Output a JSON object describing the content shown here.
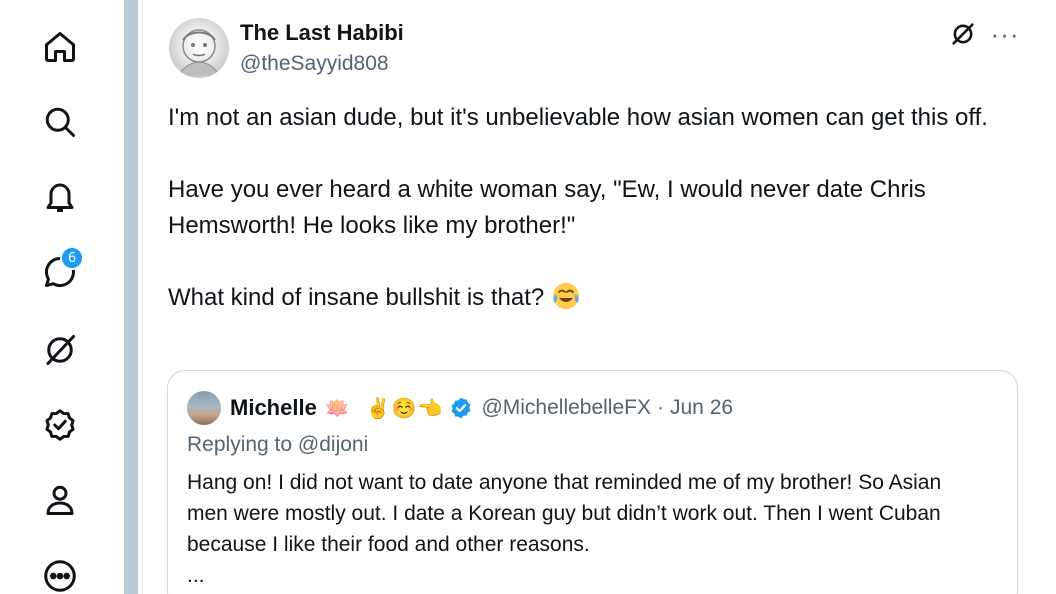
{
  "nav": {
    "items": [
      {
        "name": "home-icon"
      },
      {
        "name": "search-icon"
      },
      {
        "name": "notifications-icon"
      },
      {
        "name": "messages-icon"
      },
      {
        "name": "grok-icon"
      },
      {
        "name": "verified-orgs-icon"
      },
      {
        "name": "profile-icon"
      },
      {
        "name": "more-icon"
      }
    ],
    "messages_badge": "6"
  },
  "tweet": {
    "author_name": "The Last Habibi",
    "author_handle": "@theSayyid808",
    "text": {
      "line1": "I'm not an asian dude, but it's unbelievable how asian women can get this off.",
      "line2": "Have you ever heard a white woman say, \"Ew, I would never date Chris Hemsworth! He looks like my brother!\"",
      "line3": "What kind of insane bullshit is that?"
    },
    "emoji_icon": "face-with-tears-of-joy-icon"
  },
  "quote": {
    "author_name": "Michelle",
    "name_emoji": "🪷",
    "emojis": "✌️☺️👈",
    "handle": "@MichellebelleFX",
    "separator": "·",
    "date": "Jun 26",
    "replying_prefix": "Replying to",
    "replying_handle": "@dijoni",
    "body": "Hang on!  I did not want to date anyone that reminded me of my brother! So Asian men were mostly out.  I date a Korean guy but didn’t work out. Then I went Cuban because I like their food and other reasons.",
    "ellipsis": "..."
  },
  "colors": {
    "text": "#0f1419",
    "secondary": "#536471",
    "accent": "#1d9bf0",
    "border": "#cfd9de",
    "left_bar": "#b9cbd6"
  }
}
